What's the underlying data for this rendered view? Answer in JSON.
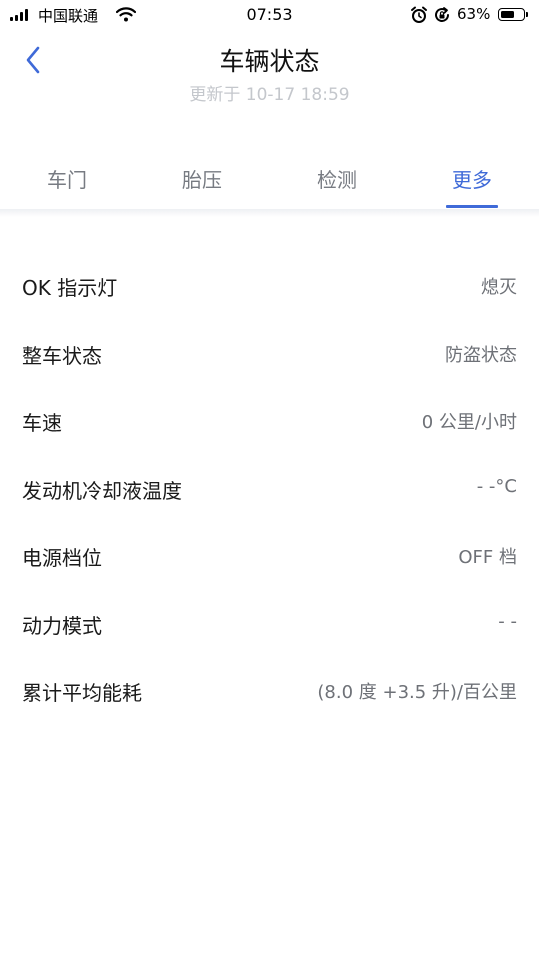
{
  "status_bar": {
    "carrier": "中国联通",
    "time": "07:53",
    "battery_percent": "63%",
    "battery_level": 0.63
  },
  "header": {
    "title": "车辆状态",
    "subtitle": "更新于 10-17 18:59",
    "back_icon": "chevron-left-icon"
  },
  "tabs": [
    {
      "label": "车门",
      "active": false
    },
    {
      "label": "胎压",
      "active": false
    },
    {
      "label": "检测",
      "active": false
    },
    {
      "label": "更多",
      "active": true
    }
  ],
  "status_items": [
    {
      "label": "OK 指示灯",
      "value": "熄灭"
    },
    {
      "label": "整车状态",
      "value": "防盗状态"
    },
    {
      "label": "车速",
      "value": "0 公里/小时"
    },
    {
      "label": "发动机冷却液温度",
      "value": "- -°C"
    },
    {
      "label": "电源档位",
      "value": "OFF 档"
    },
    {
      "label": "动力模式",
      "value": "- -"
    },
    {
      "label": "累计平均能耗",
      "value": "(8.0 度 +3.5 升)/百公里"
    }
  ],
  "colors": {
    "accent": "#3f6ad8",
    "subtitle": "#c4c7cc",
    "tab_inactive": "#777b82",
    "value_text": "#6e7177"
  }
}
